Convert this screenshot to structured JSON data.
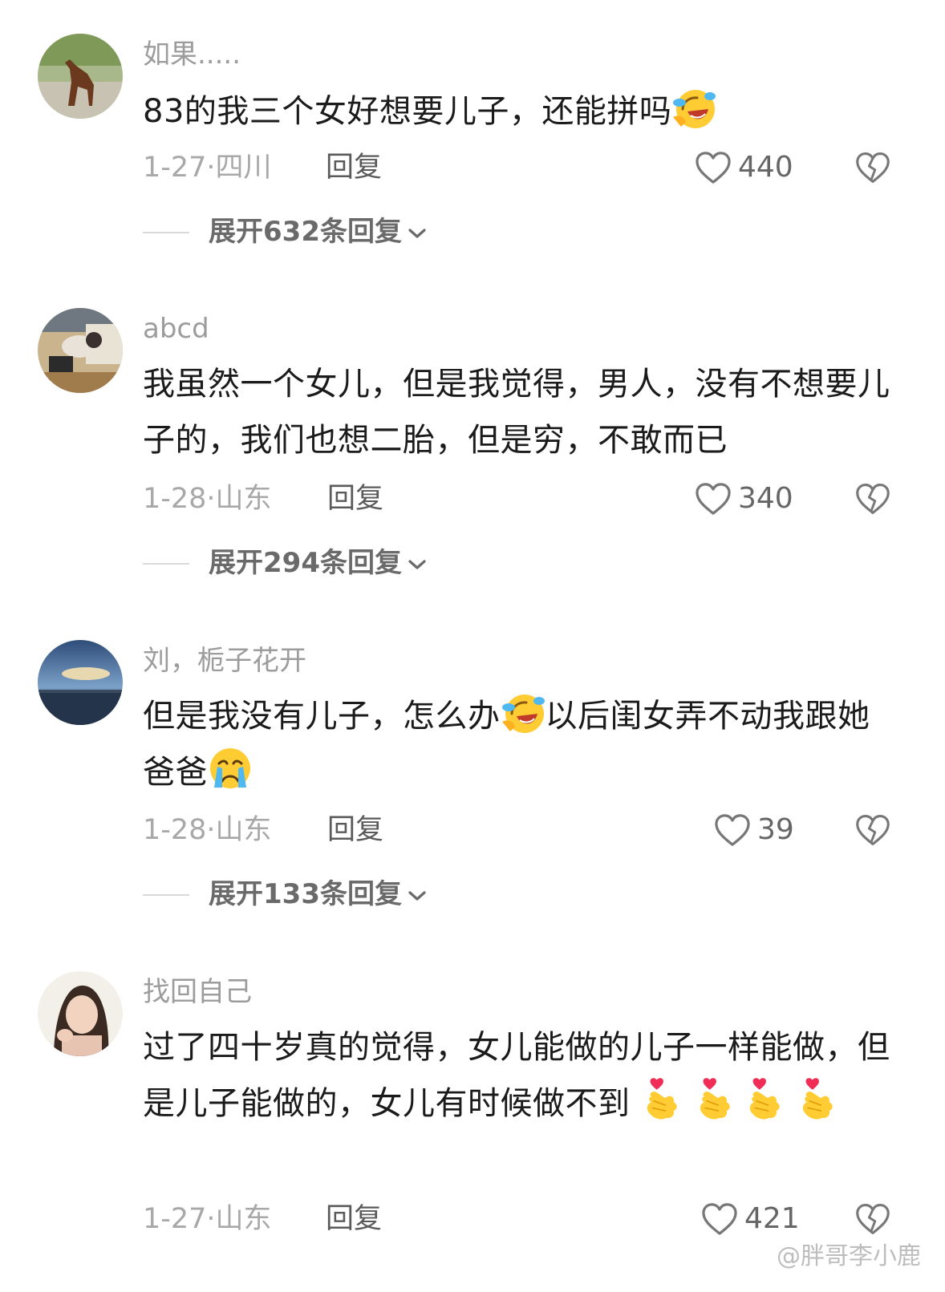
{
  "comments": [
    {
      "username": "如果.....",
      "text_a": "83的我三个女好想要儿子，还能拼吗",
      "emoji_a": "laughing-crying-emoji",
      "date": "1-27·四川",
      "reply": "回复",
      "likes": "440",
      "expand": "展开632条回复"
    },
    {
      "username": "abcd",
      "text_a": "我虽然一个女儿，但是我觉得，男人，没有不想要儿子的，我们也想二胎，但是穷，不敢而已",
      "date": "1-28·山东",
      "reply": "回复",
      "likes": "340",
      "expand": "展开294条回复"
    },
    {
      "username": "刘，栀子花开",
      "text_a": "但是我没有儿子，怎么办",
      "emoji_a": "laughing-crying-emoji",
      "text_b": "以后闺女弄不动我跟她爸爸",
      "emoji_b": "crying-face-emoji",
      "date": "1-28·山东",
      "reply": "回复",
      "likes": "39",
      "expand": "展开133条回复"
    },
    {
      "username": "找回自己",
      "text_a": "过了四十岁真的觉得，女儿能做的儿子一样能做，但是儿子能做的，女儿有时候做不到",
      "emoji_a": "finger-heart-emoji",
      "date": "1-27·山东",
      "reply": "回复",
      "likes": "421"
    }
  ],
  "watermark": "@胖哥李小鹿",
  "colors": {
    "meta_gray": "#a8a8a8",
    "username_gray": "#9c9c9c",
    "text": "#1b1b1b"
  }
}
